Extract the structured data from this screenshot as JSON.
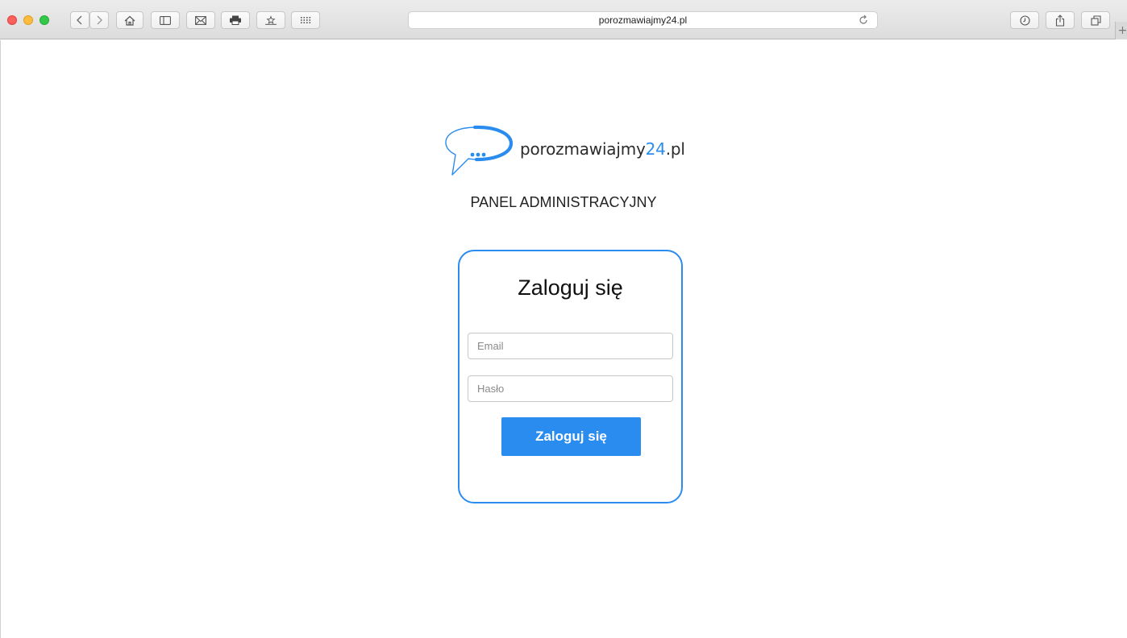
{
  "browser": {
    "url": "porozmawiajmy24.pl",
    "icons": {
      "back": "chevron-left-icon",
      "forward": "chevron-right-icon",
      "home": "home-icon",
      "sidebar": "sidebar-icon",
      "mail": "mail-icon",
      "print": "print-icon",
      "bookmark": "bookmark-star-icon",
      "topsites": "grid-icon",
      "reload": "reload-icon",
      "history": "clock-icon",
      "share": "share-icon",
      "tabs": "tabs-icon",
      "newtab": "plus-icon"
    },
    "new_tab_glyph": "+"
  },
  "logo": {
    "brand_main": "porozmawiajmy",
    "brand_number": "24",
    "brand_tld": ".pl",
    "bubble_dots": "..."
  },
  "page": {
    "heading": "PANEL ADMINISTRACYJNY"
  },
  "login": {
    "title": "Zaloguj się",
    "email_placeholder": "Email",
    "email_value": "",
    "password_placeholder": "Hasło",
    "password_value": "",
    "submit_label": "Zaloguj się"
  },
  "colors": {
    "accent": "#2a8cef",
    "text": "#222222",
    "background": "#ffffff"
  }
}
